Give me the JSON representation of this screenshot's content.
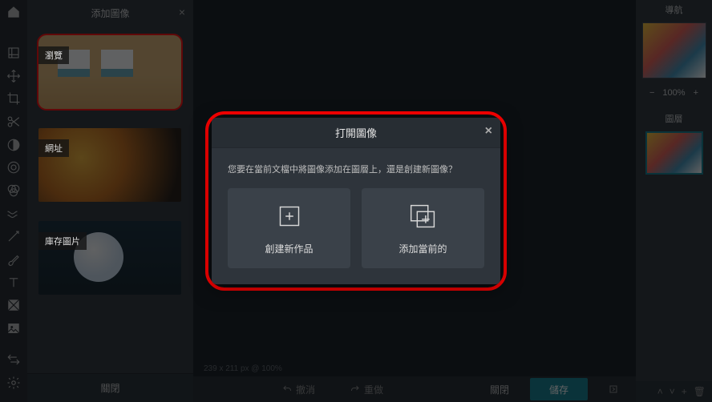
{
  "leftPanel": {
    "title": "添加圖像",
    "close": "×",
    "thumbs": [
      {
        "label": "瀏覽",
        "highlighted": true
      },
      {
        "label": "網址",
        "highlighted": false
      },
      {
        "label": "庫存圖片",
        "highlighted": false
      }
    ],
    "footerBtn": "關閉"
  },
  "toolbar": {
    "items": [
      "home",
      "expand",
      "arrows",
      "crop",
      "scissors",
      "adjust",
      "iris",
      "filter",
      "waves",
      "wand",
      "brush",
      "text",
      "pattern",
      "image"
    ],
    "bottom": [
      "swap",
      "gear"
    ]
  },
  "bottom": {
    "status": "239 x 211 px @ 100%",
    "undo": "撤消",
    "redo": "重做",
    "close": "關閉",
    "save": "儲存",
    "export": ""
  },
  "rightPanel": {
    "navTitle": "導航",
    "zoomMinus": "−",
    "zoom": "100%",
    "zoomPlus": "+",
    "layersTitle": "圖層"
  },
  "modal": {
    "title": "打開圖像",
    "close": "×",
    "question": "您要在當前文檔中將圖像添加在圖層上，還是創建新圖像？",
    "optCreate": "創建新作品",
    "optAdd": "添加當前的"
  }
}
